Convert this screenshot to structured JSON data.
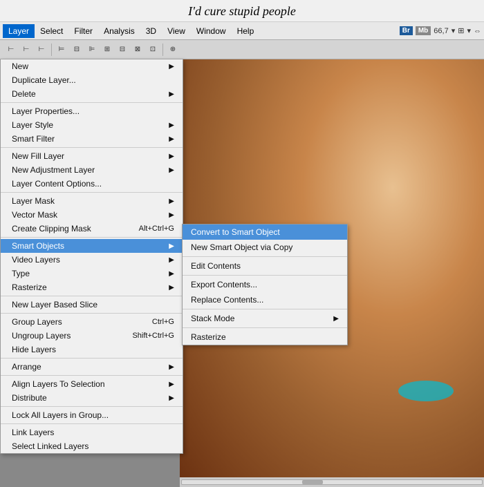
{
  "title": "I'd cure stupid people",
  "menubar": {
    "items": [
      "Layer",
      "Select",
      "Filter",
      "Analysis",
      "3D",
      "View",
      "Window",
      "Help"
    ],
    "active": "Layer",
    "right": {
      "ps": "Br",
      "mb": "Mb",
      "zoom": "66,7"
    }
  },
  "layerMenu": {
    "items": [
      {
        "label": "New",
        "hasArrow": true,
        "shortcut": ""
      },
      {
        "label": "Duplicate Layer...",
        "hasArrow": false,
        "shortcut": ""
      },
      {
        "label": "Delete",
        "hasArrow": true,
        "shortcut": ""
      },
      {
        "sep": true
      },
      {
        "label": "Layer Properties...",
        "hasArrow": false,
        "shortcut": ""
      },
      {
        "label": "Layer Style",
        "hasArrow": true,
        "shortcut": ""
      },
      {
        "label": "Smart Filter",
        "hasArrow": true,
        "shortcut": ""
      },
      {
        "sep": true
      },
      {
        "label": "New Fill Layer",
        "hasArrow": true,
        "shortcut": ""
      },
      {
        "label": "New Adjustment Layer",
        "hasArrow": true,
        "shortcut": ""
      },
      {
        "label": "Layer Content Options...",
        "hasArrow": false,
        "shortcut": ""
      },
      {
        "sep": true
      },
      {
        "label": "Layer Mask",
        "hasArrow": true,
        "shortcut": ""
      },
      {
        "label": "Vector Mask",
        "hasArrow": true,
        "shortcut": ""
      },
      {
        "label": "Create Clipping Mask",
        "hasArrow": false,
        "shortcut": "Alt+Ctrl+G"
      },
      {
        "sep": true
      },
      {
        "label": "Smart Objects",
        "hasArrow": true,
        "shortcut": "",
        "highlighted": true
      },
      {
        "label": "Video Layers",
        "hasArrow": true,
        "shortcut": ""
      },
      {
        "label": "Type",
        "hasArrow": true,
        "shortcut": ""
      },
      {
        "label": "Rasterize",
        "hasArrow": true,
        "shortcut": ""
      },
      {
        "sep": true
      },
      {
        "label": "New Layer Based Slice",
        "hasArrow": false,
        "shortcut": ""
      },
      {
        "sep": true
      },
      {
        "label": "Group Layers",
        "hasArrow": false,
        "shortcut": "Ctrl+G"
      },
      {
        "label": "Ungroup Layers",
        "hasArrow": false,
        "shortcut": "Shift+Ctrl+G"
      },
      {
        "label": "Hide Layers",
        "hasArrow": false,
        "shortcut": ""
      },
      {
        "sep": true
      },
      {
        "label": "Arrange",
        "hasArrow": true,
        "shortcut": ""
      },
      {
        "sep": true
      },
      {
        "label": "Align Layers To Selection",
        "hasArrow": true,
        "shortcut": ""
      },
      {
        "label": "Distribute",
        "hasArrow": true,
        "shortcut": ""
      },
      {
        "sep": true
      },
      {
        "label": "Lock All Layers in Group...",
        "hasArrow": false,
        "shortcut": ""
      },
      {
        "sep": true
      },
      {
        "label": "Link Layers",
        "hasArrow": false,
        "shortcut": ""
      },
      {
        "label": "Select Linked Layers",
        "hasArrow": false,
        "shortcut": ""
      }
    ]
  },
  "submenu": {
    "items": [
      {
        "label": "Convert to Smart Object",
        "highlighted": true
      },
      {
        "label": "New Smart Object via Copy"
      },
      {
        "sep": true
      },
      {
        "label": "Edit Contents"
      },
      {
        "sep": true
      },
      {
        "label": "Export Contents..."
      },
      {
        "label": "Replace Contents..."
      },
      {
        "sep": true
      },
      {
        "label": "Stack Mode",
        "hasArrow": true
      },
      {
        "sep": true
      },
      {
        "label": "Rasterize"
      }
    ]
  }
}
